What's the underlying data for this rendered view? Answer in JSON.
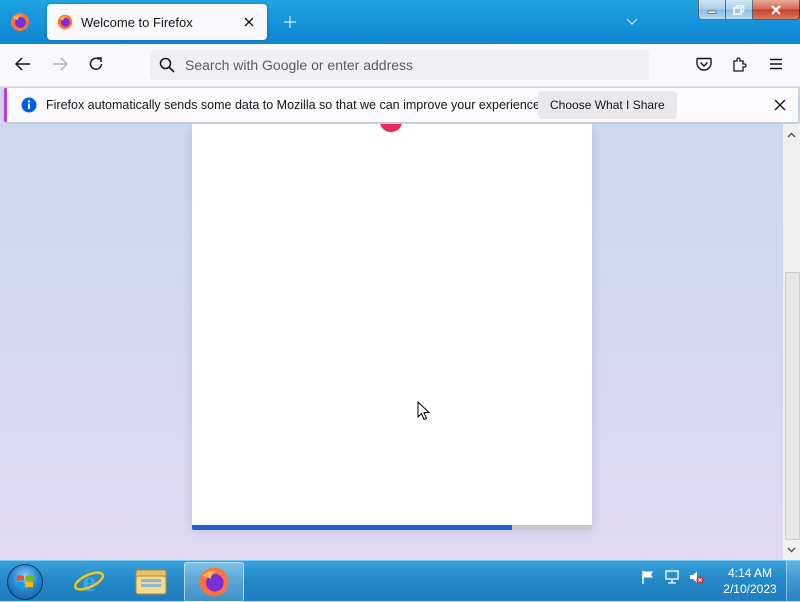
{
  "window": {
    "tab_title": "Welcome to Firefox",
    "icons": {
      "firefox_menu": "firefox-logo-icon",
      "tab_favicon": "firefox-logo-icon",
      "tab_close": "close-icon",
      "new_tab": "plus-icon",
      "tab_list": "chevron-down-icon",
      "minimize": "minimize-icon",
      "maximize": "restore-icon",
      "close": "close-icon"
    }
  },
  "navbar": {
    "url_placeholder": "Search with Google or enter address",
    "url_value": "",
    "icons": {
      "back": "arrow-left-icon",
      "forward": "arrow-right-icon",
      "reload": "reload-icon",
      "search": "search-icon",
      "pocket": "pocket-icon",
      "extensions": "puzzle-icon",
      "menu": "hamburger-menu-icon"
    }
  },
  "notification": {
    "message": "Firefox automatically sends some data to Mozilla so that we can improve your experience.",
    "button_label": "Choose What I Share",
    "icons": {
      "info": "info-icon",
      "close": "close-icon"
    },
    "accent_color": "#c33ad6"
  },
  "content": {
    "progress_fraction": 0.8,
    "progress_color": "#1f5fd0",
    "dot_color": "#ea2a5b"
  },
  "taskbar": {
    "items": [
      {
        "name": "internet-explorer",
        "icon": "internet-explorer-icon"
      },
      {
        "name": "file-explorer",
        "icon": "folder-icon"
      },
      {
        "name": "firefox",
        "icon": "firefox-logo-icon",
        "active": true
      }
    ],
    "tray_icons": [
      "flag-icon",
      "network-icon",
      "volume-muted-icon"
    ],
    "clock": {
      "time": "4:14 AM",
      "date": "2/10/2023"
    }
  }
}
